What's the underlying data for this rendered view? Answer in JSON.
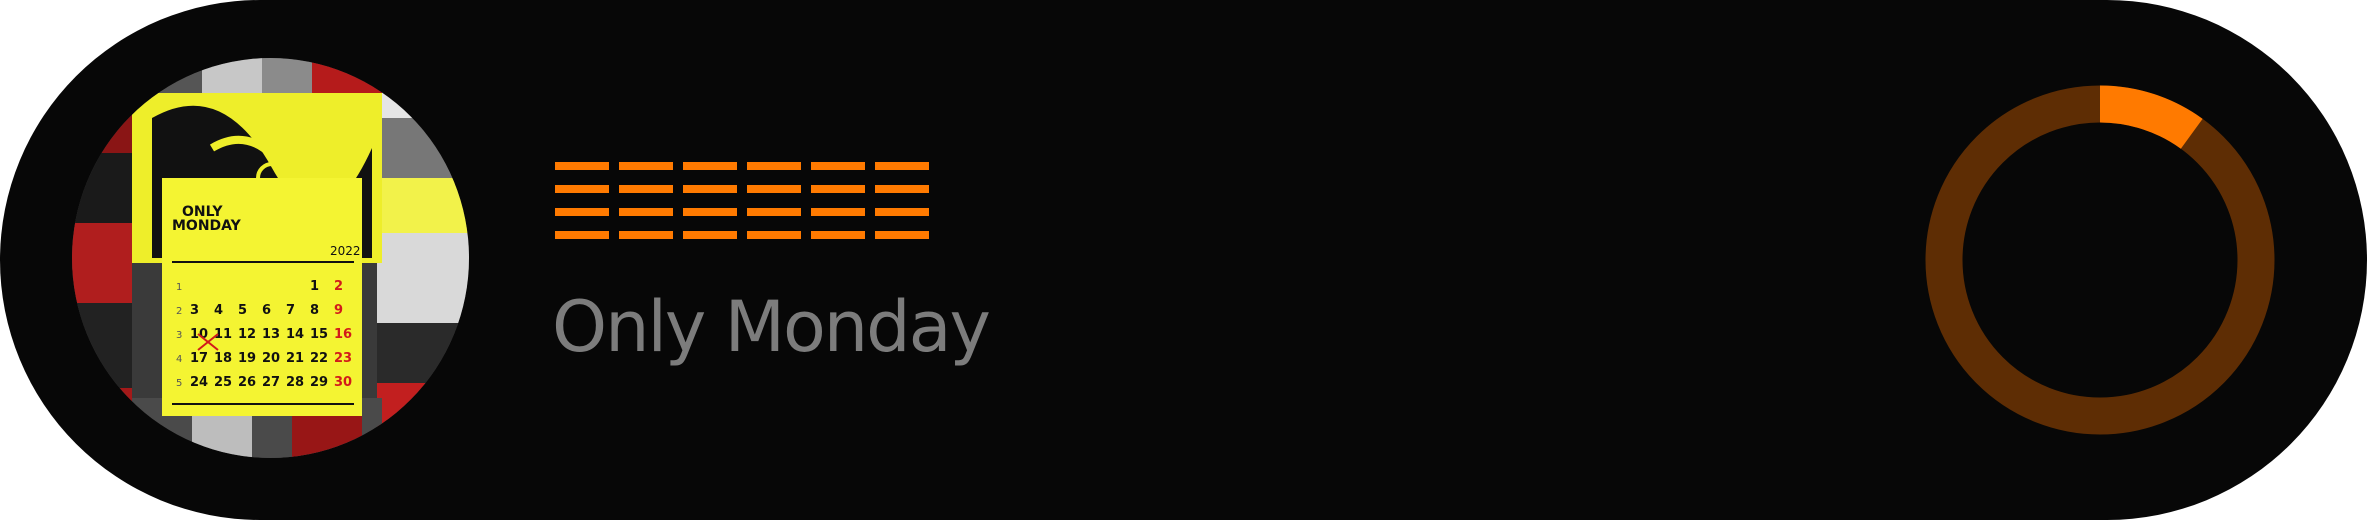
{
  "track": {
    "title": "Only Monday"
  },
  "artwork": {
    "brand": "ONLY MONDAY",
    "year": "2022",
    "calendar_rows": [
      [
        "1",
        "",
        "",
        "",
        "",
        "",
        "1",
        "2"
      ],
      [
        "2",
        "3",
        "4",
        "5",
        "6",
        "7",
        "8",
        "9"
      ],
      [
        "3",
        "10",
        "11",
        "12",
        "13",
        "14",
        "15",
        "16"
      ],
      [
        "4",
        "17",
        "18",
        "19",
        "20",
        "21",
        "22",
        "23"
      ],
      [
        "5",
        "24",
        "25",
        "26",
        "27",
        "28",
        "29",
        "30"
      ]
    ]
  },
  "progress": {
    "fraction": 0.1
  },
  "colors": {
    "accent": "#ff7a00",
    "ring_track": "#5e2d04",
    "card_bg": "#070707",
    "title": "#7c7c7c",
    "calendar_yellow": "#f4f432",
    "sunday_red": "#d21a1a"
  },
  "icons": {
    "equalizer": "equalizer-icon"
  }
}
